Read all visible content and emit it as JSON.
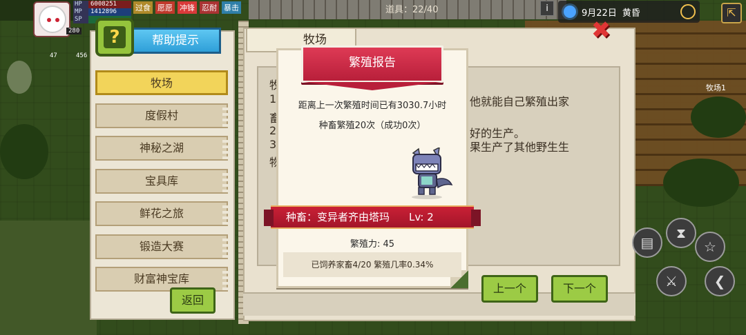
{
  "hud": {
    "hp_label": "HP",
    "hp_value": "6008251",
    "mp_label": "MP",
    "mp_value": "1412896",
    "sp_label": "SP",
    "tags": [
      "过食",
      "愿愿",
      "冲锋",
      "忍耐",
      "暴击"
    ],
    "level": "280",
    "count_left": "47",
    "count_right": "456",
    "items": "道具：22/40",
    "info": "i",
    "date": "9月22日",
    "time_of_day": "黄昏",
    "map_label": "牧场1"
  },
  "help": {
    "title": "帮助提示",
    "q_mark": "?",
    "menu": [
      "牧场",
      "度假村",
      "神秘之湖",
      "宝具库",
      "鲜花之旅",
      "锻造大赛",
      "财富神宝库"
    ],
    "active_index": 0,
    "back": "返回"
  },
  "ranch": {
    "tab": "牧场",
    "partial_lines": [
      {
        "left": "牧",
        "right": ""
      },
      {
        "left": "1",
        "right": "他就能自己繁殖出家"
      },
      {
        "left": "畜",
        "right": ""
      },
      {
        "left": "2",
        "right": "好的生产。"
      },
      {
        "left": "3",
        "right": "果生产了其他野生生"
      },
      {
        "left": "物",
        "right": ""
      }
    ],
    "prev": "上一个",
    "next": "下一个",
    "close": "✖"
  },
  "report": {
    "title": "繁殖报告",
    "elapsed": "距离上一次繁殖时间已有3030.7小时",
    "attempts": "种畜繁殖20次（成功0次）",
    "species_label": "种畜：变异者齐由塔玛",
    "level_label": "Lv:  2",
    "breeding_power": "繁殖力:  45",
    "footer": "已饲养家畜4/20 繁殖几率0.34%"
  },
  "colors": {
    "ribbon_red": "#c92035",
    "button_green": "#9ccb45",
    "active_menu": "#f2d45a",
    "help_blue": "#2f9fd8"
  }
}
